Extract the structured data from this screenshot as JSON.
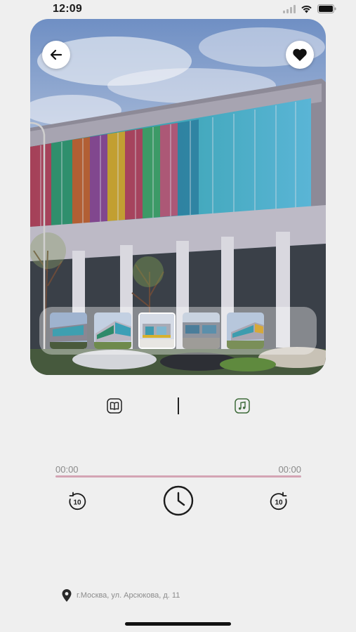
{
  "status_bar": {
    "time": "12:09"
  },
  "player": {
    "current_time": "00:00",
    "total_time": "00:00",
    "progress": 0
  },
  "location": {
    "address": "г.Москва, ул. Арсюкова, д. 11"
  },
  "icons": {
    "back": "arrow-left-icon",
    "favorite": "heart-icon",
    "read_mode": "book-icon",
    "audio_mode": "music-note-icon",
    "rewind": "rewind-10-icon",
    "play": "clock-icon",
    "forward": "forward-10-icon",
    "location": "map-pin-icon"
  },
  "colors": {
    "background": "#efefef",
    "progress_track": "#d4a4b4",
    "audio_mode_accent": "#3e6b3a",
    "text_muted": "#8a8a8a"
  }
}
